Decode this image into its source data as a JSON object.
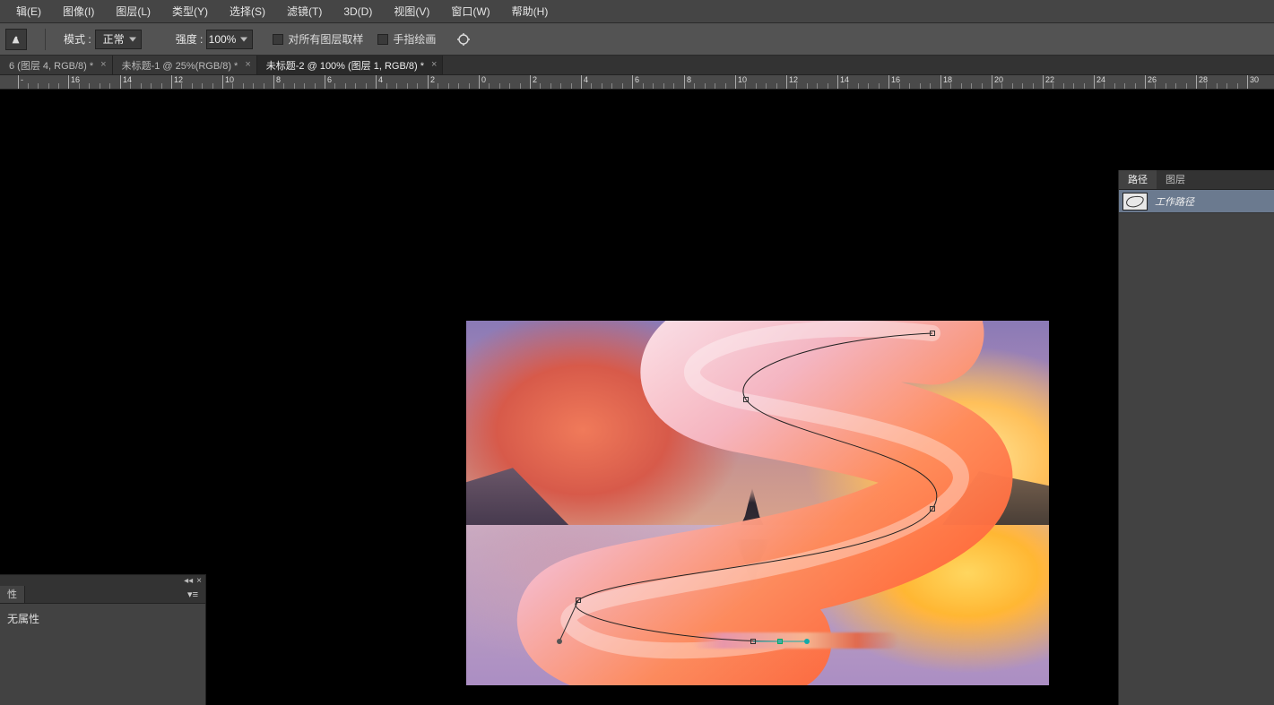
{
  "menu": {
    "items": [
      "辑(E)",
      "图像(I)",
      "图层(L)",
      "类型(Y)",
      "选择(S)",
      "滤镜(T)",
      "3D(D)",
      "视图(V)",
      "窗口(W)",
      "帮助(H)"
    ]
  },
  "options": {
    "mode_label": "模式 :",
    "mode_value": "正常",
    "strength_label": "强度 :",
    "strength_value": "100%",
    "sample_all_label": "对所有图层取样",
    "finger_paint_label": "手指绘画"
  },
  "tabs": [
    {
      "title": "6 (图层 4, RGB/8) *",
      "active": false
    },
    {
      "title": "未标题-1 @ 25%(RGB/8) *",
      "active": false
    },
    {
      "title": "未标题-2 @ 100% (图层 1, RGB/8) *",
      "active": true
    }
  ],
  "ruler": {
    "majors": [
      {
        "px": 20,
        "label": "-"
      },
      {
        "px": 76,
        "label": "16"
      },
      {
        "px": 134,
        "label": "14"
      },
      {
        "px": 191,
        "label": "12"
      },
      {
        "px": 248,
        "label": "10"
      },
      {
        "px": 305,
        "label": "8"
      },
      {
        "px": 362,
        "label": "6"
      },
      {
        "px": 419,
        "label": "4"
      },
      {
        "px": 477,
        "label": "2"
      },
      {
        "px": 534,
        "label": "0"
      },
      {
        "px": 591,
        "label": "2"
      },
      {
        "px": 648,
        "label": "4"
      },
      {
        "px": 705,
        "label": "6"
      },
      {
        "px": 763,
        "label": "8"
      },
      {
        "px": 820,
        "label": "10"
      },
      {
        "px": 877,
        "label": "12"
      },
      {
        "px": 934,
        "label": "14"
      },
      {
        "px": 991,
        "label": "16"
      },
      {
        "px": 1049,
        "label": "18"
      },
      {
        "px": 1106,
        "label": "20"
      },
      {
        "px": 1163,
        "label": "22"
      },
      {
        "px": 1220,
        "label": "24"
      },
      {
        "px": 1277,
        "label": "26"
      },
      {
        "px": 1334,
        "label": "28"
      },
      {
        "px": 1391,
        "label": "30"
      }
    ]
  },
  "properties_panel": {
    "tab_label": "性",
    "body_text": "无属性"
  },
  "paths_panel": {
    "tabs": [
      "路径",
      "图层"
    ],
    "active_tab": 0,
    "items": [
      {
        "name": "工作路径"
      }
    ]
  }
}
